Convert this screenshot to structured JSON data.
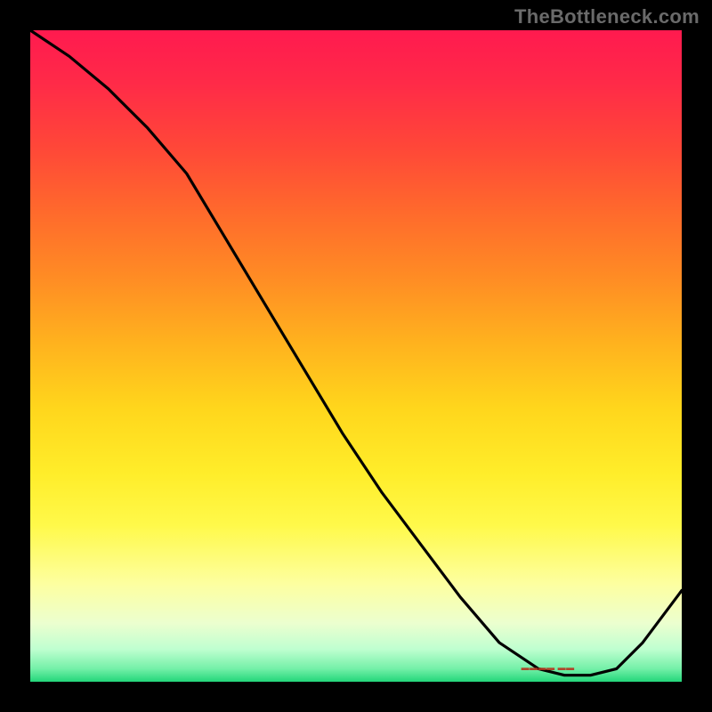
{
  "watermark": "TheBottleneck.com",
  "bottom_glyph": "▬▬▬▬ ▬▬",
  "colors": {
    "line": "#000000",
    "glyph": "#b5361f",
    "watermark": "#6a6a6a"
  },
  "chart_data": {
    "type": "line",
    "title": "",
    "xlabel": "",
    "ylabel": "",
    "xlim": [
      0,
      100
    ],
    "ylim": [
      0,
      100
    ],
    "series": [
      {
        "name": "curve",
        "x": [
          0,
          6,
          12,
          18,
          24,
          30,
          36,
          42,
          48,
          54,
          60,
          66,
          72,
          78,
          82,
          86,
          90,
          94,
          100
        ],
        "values": [
          100,
          96,
          91,
          85,
          78,
          68,
          58,
          48,
          38,
          29,
          21,
          13,
          6,
          2,
          1,
          1,
          2,
          6,
          14
        ]
      }
    ],
    "annotations": [
      {
        "name": "bottom-dash",
        "x": 80,
        "y": 2
      }
    ]
  }
}
